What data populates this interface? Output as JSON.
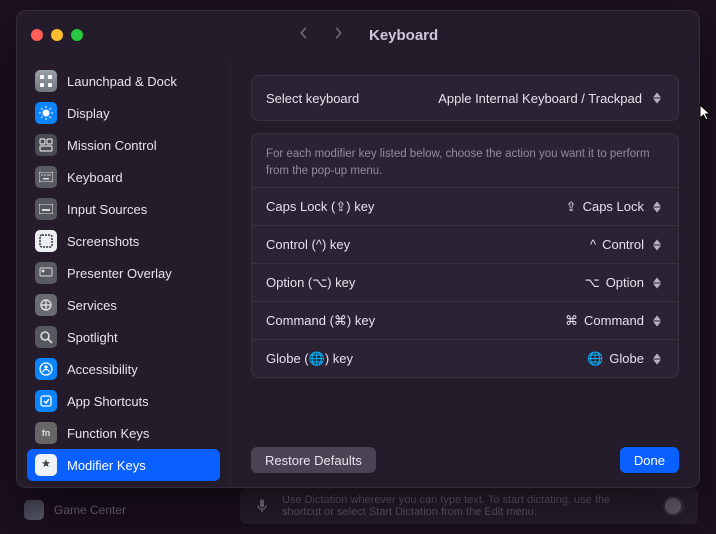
{
  "window": {
    "title": "Keyboard"
  },
  "sidebar": {
    "items": [
      {
        "label": "Launchpad & Dock",
        "name": "launchpad-dock"
      },
      {
        "label": "Display",
        "name": "display"
      },
      {
        "label": "Mission Control",
        "name": "mission-control"
      },
      {
        "label": "Keyboard",
        "name": "keyboard"
      },
      {
        "label": "Input Sources",
        "name": "input-sources"
      },
      {
        "label": "Screenshots",
        "name": "screenshots"
      },
      {
        "label": "Presenter Overlay",
        "name": "presenter-overlay"
      },
      {
        "label": "Services",
        "name": "services"
      },
      {
        "label": "Spotlight",
        "name": "spotlight"
      },
      {
        "label": "Accessibility",
        "name": "accessibility"
      },
      {
        "label": "App Shortcuts",
        "name": "app-shortcuts"
      },
      {
        "label": "Function Keys",
        "name": "function-keys"
      },
      {
        "label": "Modifier Keys",
        "name": "modifier-keys"
      }
    ],
    "active_index": 12
  },
  "select_keyboard": {
    "label": "Select keyboard",
    "value": "Apple Internal Keyboard / Trackpad"
  },
  "helper_text": "For each modifier key listed below, choose the action you want it to perform from the pop-up menu.",
  "modifiers": [
    {
      "label": "Caps Lock (⇪) key",
      "symbol": "⇪",
      "value": "Caps Lock"
    },
    {
      "label": "Control (^) key",
      "symbol": "^",
      "value": "Control"
    },
    {
      "label": "Option (⌥) key",
      "symbol": "⌥",
      "value": "Option"
    },
    {
      "label": "Command (⌘) key",
      "symbol": "⌘",
      "value": "Command"
    },
    {
      "label": "Globe (🌐) key",
      "symbol": "🌐",
      "value": "Globe"
    }
  ],
  "buttons": {
    "restore": "Restore Defaults",
    "done": "Done"
  },
  "background": {
    "dictation_text": "Use Dictation wherever you can type text. To start dictating, use the shortcut or select Start Dictation from the Edit menu.",
    "game_center": "Game Center"
  }
}
